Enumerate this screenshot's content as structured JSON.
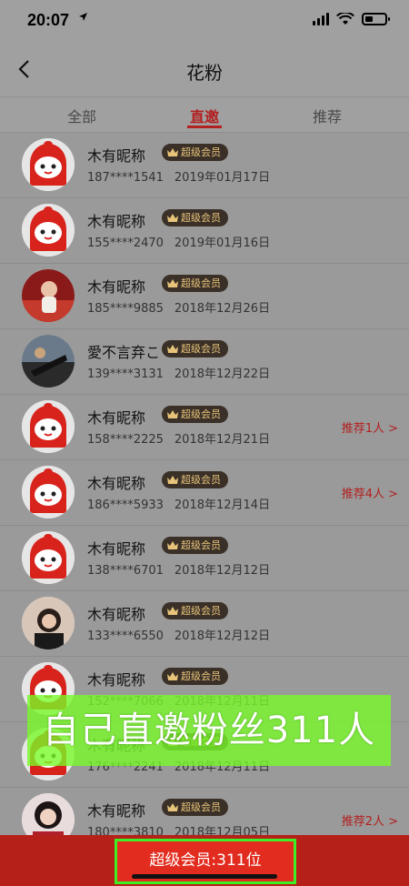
{
  "status": {
    "time": "20:07",
    "location_icon": "location-arrow-icon"
  },
  "nav": {
    "title": "花粉",
    "back_icon": "chevron-left-icon"
  },
  "tabs": [
    {
      "label": "全部",
      "active": false
    },
    {
      "label": "直邀",
      "active": true
    },
    {
      "label": "推荐",
      "active": false
    }
  ],
  "colors": {
    "accent": "#b32020",
    "badge_bg": "#3a3028",
    "badge_text": "#e8c47a",
    "overlay_green": "#78fa28"
  },
  "members": [
    {
      "name": "木有昵称",
      "badge": "超级会员",
      "phone": "187****1541",
      "date": "2019年01月17日",
      "recommend": "",
      "avatar": "mascot"
    },
    {
      "name": "木有昵称",
      "badge": "超级会员",
      "phone": "155****2470",
      "date": "2019年01月16日",
      "recommend": "",
      "avatar": "mascot"
    },
    {
      "name": "木有昵称",
      "badge": "超级会员",
      "phone": "185****9885",
      "date": "2018年12月26日",
      "recommend": "",
      "avatar": "baby-photo"
    },
    {
      "name": "愛不言弃こ",
      "badge": "超级会员",
      "phone": "139****3131",
      "date": "2018年12月22日",
      "recommend": "",
      "avatar": "dark-photo"
    },
    {
      "name": "木有昵称",
      "badge": "超级会员",
      "phone": "158****2225",
      "date": "2018年12月21日",
      "recommend": "推荐1人 >",
      "avatar": "mascot"
    },
    {
      "name": "木有昵称",
      "badge": "超级会员",
      "phone": "186****5933",
      "date": "2018年12月14日",
      "recommend": "推荐4人 >",
      "avatar": "mascot"
    },
    {
      "name": "木有昵称",
      "badge": "超级会员",
      "phone": "138****6701",
      "date": "2018年12月12日",
      "recommend": "",
      "avatar": "mascot"
    },
    {
      "name": "木有昵称",
      "badge": "超级会员",
      "phone": "133****6550",
      "date": "2018年12月12日",
      "recommend": "",
      "avatar": "girl-photo"
    },
    {
      "name": "木有昵称",
      "badge": "超级会员",
      "phone": "152****7066",
      "date": "2018年12月11日",
      "recommend": "",
      "avatar": "mascot"
    },
    {
      "name": "木有昵称",
      "badge": "超级会员",
      "phone": "176****2241",
      "date": "2018年12月11日",
      "recommend": "",
      "avatar": "mascot"
    },
    {
      "name": "木有昵称",
      "badge": "超级会员",
      "phone": "180****3810",
      "date": "2018年12月05日",
      "recommend": "推荐2人 >",
      "avatar": "girl-photo-2"
    }
  ],
  "overlay": {
    "text": "自己直邀粉丝311人"
  },
  "footer": {
    "label": "超级会员:311位"
  }
}
